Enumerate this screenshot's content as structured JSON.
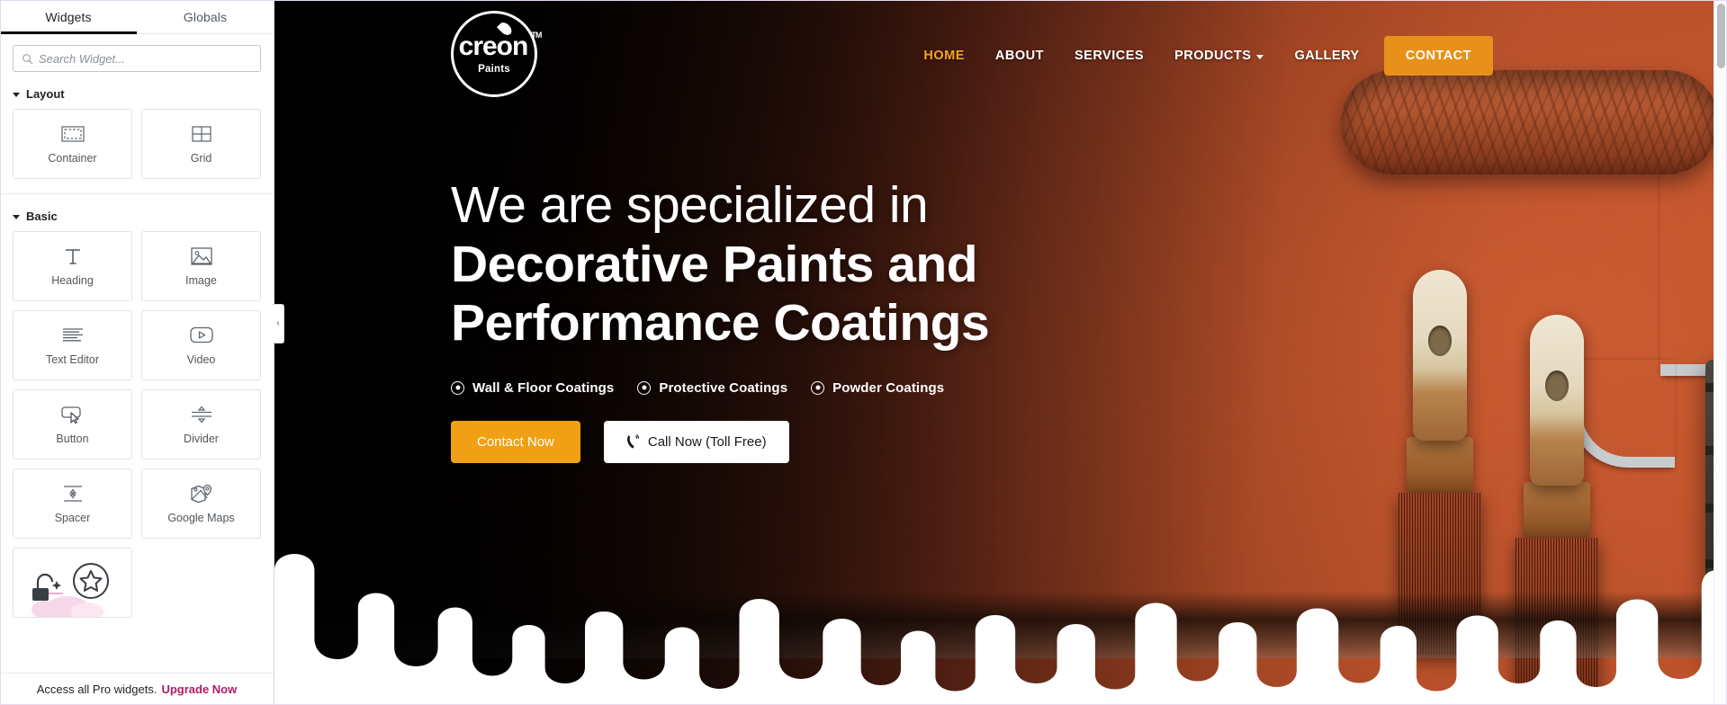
{
  "panel": {
    "tabs": [
      {
        "label": "Widgets",
        "active": true
      },
      {
        "label": "Globals",
        "active": false
      }
    ],
    "search": {
      "placeholder": "Search Widget...",
      "value": "",
      "icon": "search-icon"
    },
    "sections": [
      {
        "title": "Layout",
        "expanded": true,
        "widgets": [
          {
            "label": "Container",
            "icon": "container-icon"
          },
          {
            "label": "Grid",
            "icon": "grid-icon"
          }
        ]
      },
      {
        "title": "Basic",
        "expanded": true,
        "widgets": [
          {
            "label": "Heading",
            "icon": "heading-icon"
          },
          {
            "label": "Image",
            "icon": "image-icon"
          },
          {
            "label": "Text Editor",
            "icon": "text-editor-icon"
          },
          {
            "label": "Video",
            "icon": "video-icon"
          },
          {
            "label": "Button",
            "icon": "button-icon"
          },
          {
            "label": "Divider",
            "icon": "divider-icon"
          },
          {
            "label": "Spacer",
            "icon": "spacer-icon"
          },
          {
            "label": "Google Maps",
            "icon": "google-maps-icon"
          }
        ]
      }
    ],
    "pro_card": {
      "icon": "pro-lock-star-icon"
    },
    "promo": {
      "text": "Access all Pro widgets.",
      "link_label": "Upgrade Now",
      "link_color": "#b01b66"
    },
    "collapse_handle": {
      "glyph": "‹",
      "name": "collapse-panel-handle"
    }
  },
  "site": {
    "logo": {
      "word": "creon",
      "sub": "Paints",
      "tm": "TM"
    },
    "menu": [
      {
        "label": "HOME",
        "active": true,
        "has_dropdown": false
      },
      {
        "label": "ABOUT",
        "active": false,
        "has_dropdown": false
      },
      {
        "label": "SERVICES",
        "active": false,
        "has_dropdown": false
      },
      {
        "label": "PRODUCTS",
        "active": false,
        "has_dropdown": true
      },
      {
        "label": "GALLERY",
        "active": false,
        "has_dropdown": false
      }
    ],
    "contact_button": {
      "label": "CONTACT",
      "color": "#e8911a"
    },
    "hero": {
      "line1": "We are specialized in",
      "line2": "Decorative Paints and",
      "line3": "Performance Coatings",
      "features": [
        {
          "label": "Wall & Floor Coatings",
          "icon": "dot-circle-icon"
        },
        {
          "label": "Protective Coatings",
          "icon": "dot-circle-icon"
        },
        {
          "label": "Powder Coatings",
          "icon": "dot-circle-icon"
        }
      ],
      "primary_cta": {
        "label": "Contact Now",
        "color": "#f0a014"
      },
      "secondary_cta": {
        "label": "Call Now (Toll Free)",
        "icon": "phone-ring-icon"
      }
    }
  },
  "colors": {
    "accent_orange": "#e8911a",
    "cta_orange": "#f0a014",
    "active_link": "#f5a623",
    "promo_link": "#b01b66",
    "panel_border": "#d5d8dc"
  }
}
